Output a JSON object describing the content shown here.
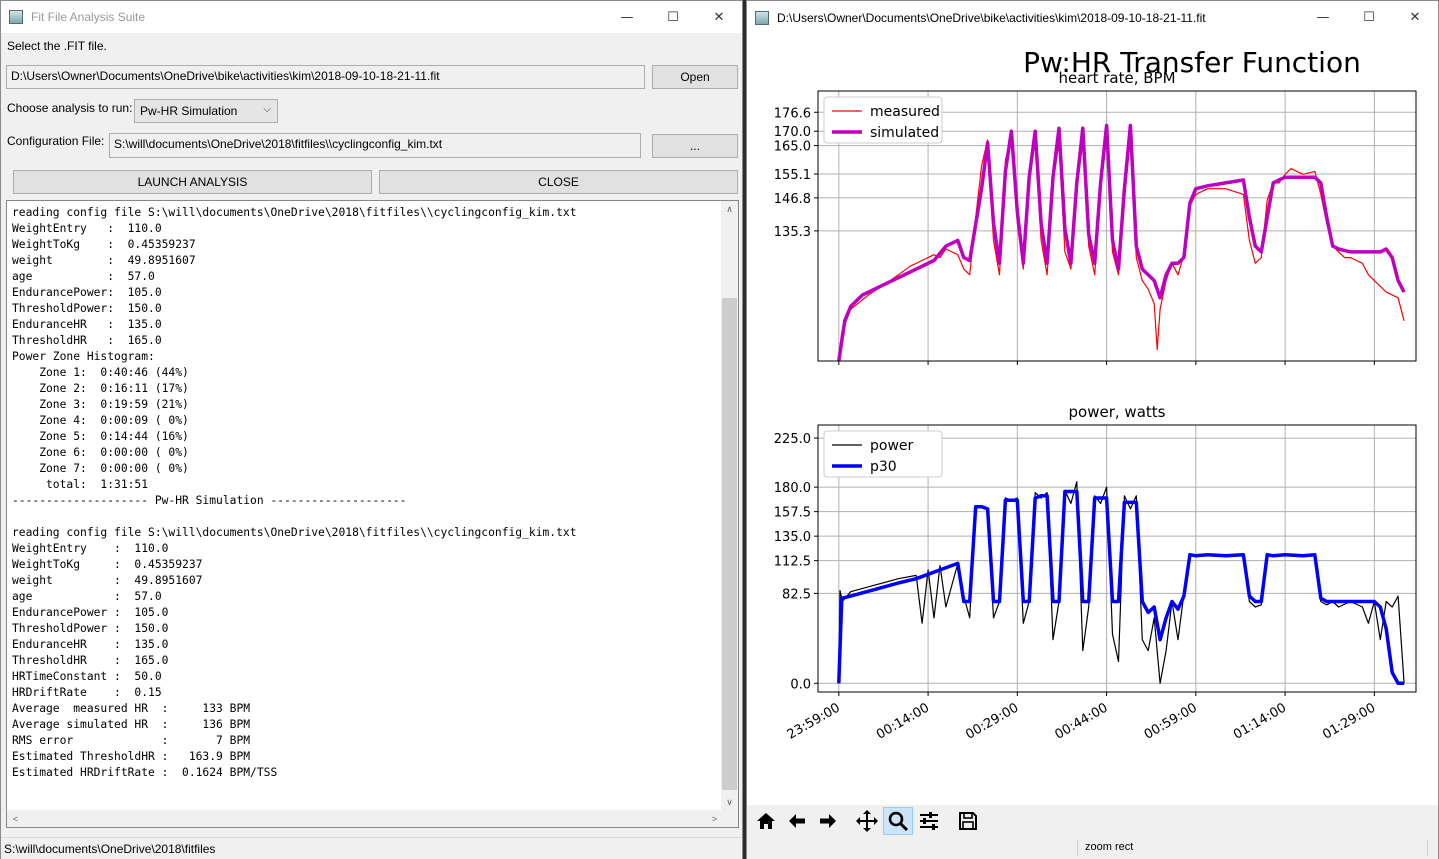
{
  "left_window": {
    "title": "Fit File Analysis Suite",
    "select_label": "Select the .FIT file.",
    "fit_path": "D:\\Users\\Owner\\Documents\\OneDrive\\bike\\activities\\kim\\2018-09-10-18-21-11.fit",
    "open_label": "Open",
    "analysis_label": "Choose analysis to run:",
    "analysis_value": "Pw-HR Simulation",
    "config_label": "Configuration File:",
    "config_path": "S:\\will\\documents\\OneDrive\\2018\\fitfiles\\\\cyclingconfig_kim.txt",
    "browse_label": "...",
    "launch_label": "LAUNCH ANALYSIS",
    "close_label": "CLOSE",
    "log_lines": [
      "reading config file S:\\will\\documents\\OneDrive\\2018\\fitfiles\\\\cyclingconfig_kim.txt",
      "WeightEntry   :  110.0",
      "WeightToKg    :  0.45359237",
      "weight        :  49.8951607",
      "age           :  57.0",
      "EndurancePower:  105.0",
      "ThresholdPower:  150.0",
      "EnduranceHR   :  135.0",
      "ThresholdHR   :  165.0",
      "Power Zone Histogram:",
      "    Zone 1:  0:40:46 (44%)",
      "    Zone 2:  0:16:11 (17%)",
      "    Zone 3:  0:19:59 (21%)",
      "    Zone 4:  0:00:09 ( 0%)",
      "    Zone 5:  0:14:44 (16%)",
      "    Zone 6:  0:00:00 ( 0%)",
      "    Zone 7:  0:00:00 ( 0%)",
      "     total:  1:31:51",
      "-------------------- Pw-HR Simulation --------------------",
      "",
      "reading config file S:\\will\\documents\\OneDrive\\2018\\fitfiles\\\\cyclingconfig_kim.txt",
      "WeightEntry    :  110.0",
      "WeightToKg     :  0.45359237",
      "weight         :  49.8951607",
      "age            :  57.0",
      "EndurancePower :  105.0",
      "ThresholdPower :  150.0",
      "EnduranceHR    :  135.0",
      "ThresholdHR    :  165.0",
      "HRTimeConstant :  50.0",
      "HRDriftRate    :  0.15",
      "Average  measured HR  :     133 BPM",
      "Average simulated HR  :     136 BPM",
      "RMS error             :       7 BPM",
      "Estimated ThresholdHR :   163.9 BPM",
      "Estimated HRDriftRate :  0.1624 BPM/TSS"
    ],
    "status": "S:\\will\\documents\\OneDrive\\2018\\fitfiles"
  },
  "right_window": {
    "title": "D:\\Users\\Owner\\Documents\\OneDrive\\bike\\activities\\kim\\2018-09-10-18-21-11.fit",
    "status": "zoom rect",
    "toolbar_icons": [
      "home-icon",
      "back-arrow-icon",
      "forward-arrow-icon",
      "pan-icon",
      "zoom-icon",
      "configure-subplots-icon",
      "save-icon"
    ],
    "active_tool": "zoom-icon"
  },
  "chart_data": [
    {
      "type": "line",
      "suptitle": "Pw:HR Transfer Function",
      "title": "heart rate, BPM",
      "yticks": [
        135.3,
        146.8,
        155.1,
        165.0,
        170.0,
        176.6
      ],
      "ylim": [
        90,
        184
      ],
      "xticks": [
        "23:59:00",
        "00:14:00",
        "00:29:00",
        "00:44:00",
        "00:59:00",
        "01:14:00",
        "01:29:00"
      ],
      "xlim_minutes": [
        -3.5,
        97
      ],
      "grid": true,
      "legend_position": "top-left",
      "series": [
        {
          "name": "measured",
          "color": "#ff0000",
          "x_minutes": [
            0,
            0.5,
            2,
            5,
            8,
            10,
            12,
            14,
            16,
            17,
            18,
            20,
            21,
            22,
            23,
            24,
            25,
            26,
            27,
            28,
            29,
            30,
            31,
            32,
            33,
            34,
            35,
            36,
            37,
            38,
            39,
            40,
            41,
            42,
            43,
            44,
            45,
            46,
            47,
            48,
            49,
            50,
            51,
            52,
            53,
            53.5,
            54,
            55,
            56,
            57,
            58,
            59,
            60,
            62,
            65,
            68,
            69,
            70,
            71,
            72,
            73,
            74,
            75,
            76,
            78,
            80,
            81,
            82,
            83,
            84,
            85,
            86,
            87,
            88,
            89,
            90,
            91,
            92,
            93,
            94,
            95
          ],
          "values": [
            92,
            100,
            108,
            113,
            117,
            120,
            123,
            125,
            127,
            126,
            129,
            127,
            122,
            120,
            140,
            158,
            167,
            132,
            120,
            160,
            168,
            138,
            122,
            155,
            168,
            132,
            120,
            152,
            166,
            128,
            122,
            150,
            166,
            130,
            120,
            150,
            168,
            128,
            120,
            146,
            168,
            126,
            118,
            115,
            110,
            94,
            108,
            118,
            124,
            120,
            127,
            144,
            148,
            150,
            150,
            148,
            132,
            124,
            126,
            146,
            152,
            152,
            155,
            157,
            155,
            156,
            148,
            138,
            130,
            128,
            126,
            126,
            125,
            124,
            120,
            118,
            116,
            114,
            113,
            112,
            104
          ]
        },
        {
          "name": "simulated",
          "color": "#bf00bf",
          "x_minutes": [
            0,
            1,
            2,
            4,
            8,
            12,
            16,
            18,
            20,
            21,
            22,
            24,
            25,
            26,
            27,
            28,
            29,
            30,
            31,
            32,
            33,
            34,
            35,
            36,
            37,
            38,
            39,
            40,
            41,
            42,
            43,
            44,
            45,
            46,
            47,
            48,
            49,
            50,
            51,
            52,
            53,
            54,
            55,
            56,
            57,
            58,
            59,
            60,
            62,
            65,
            68,
            69,
            70,
            71,
            72,
            73,
            74,
            75,
            77,
            80,
            81,
            82,
            83,
            84,
            86,
            88,
            90,
            91,
            92,
            93,
            94,
            95
          ],
          "values": [
            90,
            104,
            109,
            113,
            117,
            121,
            125,
            130,
            132,
            126,
            125,
            150,
            166,
            138,
            124,
            156,
            170,
            142,
            124,
            154,
            170,
            138,
            124,
            154,
            171,
            136,
            124,
            152,
            171,
            134,
            124,
            152,
            172,
            132,
            122,
            150,
            172,
            130,
            122,
            120,
            118,
            112,
            120,
            124,
            124,
            126,
            145,
            150,
            151,
            152,
            153,
            140,
            130,
            128,
            140,
            152,
            153,
            154,
            154,
            154,
            152,
            140,
            130,
            129,
            128,
            128,
            128,
            128,
            129,
            126,
            118,
            114
          ]
        }
      ]
    },
    {
      "type": "line",
      "title": "power, watts",
      "yticks": [
        0.0,
        82.5,
        112.5,
        135.0,
        157.5,
        180.0,
        225.0
      ],
      "ylim": [
        -8,
        237
      ],
      "xticks": [
        "23:59:00",
        "00:14:00",
        "00:29:00",
        "00:44:00",
        "00:59:00",
        "01:14:00",
        "01:29:00"
      ],
      "xlim_minutes": [
        -3.5,
        97
      ],
      "grid": true,
      "legend_position": "top-left",
      "series": [
        {
          "name": "power",
          "color": "#000000",
          "x_minutes": [
            0,
            0.2,
            0.6,
            2,
            6,
            10,
            13,
            14,
            15,
            16,
            17,
            18,
            20,
            21,
            22,
            23,
            24,
            25,
            26,
            27,
            28,
            29,
            30,
            31,
            32,
            33,
            34,
            35,
            36,
            37,
            38,
            39,
            40,
            41,
            42,
            43,
            44,
            45,
            46,
            47,
            48,
            49,
            50,
            51,
            52,
            53,
            54,
            55,
            56,
            57,
            58,
            59,
            60,
            62,
            65,
            68,
            69,
            70,
            71,
            72,
            73,
            75,
            78,
            80,
            81,
            82,
            83,
            84,
            86,
            88,
            89,
            90,
            91,
            92,
            93,
            94,
            95
          ],
          "values": [
            0,
            85,
            75,
            84,
            90,
            96,
            99,
            55,
            104,
            60,
            108,
            70,
            110,
            80,
            60,
            163,
            163,
            160,
            60,
            75,
            170,
            168,
            170,
            55,
            75,
            175,
            170,
            175,
            40,
            75,
            177,
            165,
            185,
            30,
            70,
            172,
            165,
            180,
            45,
            20,
            172,
            160,
            172,
            40,
            30,
            60,
            0,
            30,
            75,
            40,
            82,
            118,
            117,
            118,
            116,
            118,
            75,
            70,
            72,
            118,
            117,
            118,
            116,
            118,
            75,
            72,
            75,
            70,
            75,
            70,
            55,
            75,
            40,
            75,
            70,
            80,
            0
          ]
        },
        {
          "name": "p30",
          "color": "#0000ff",
          "x_minutes": [
            0,
            0.5,
            2,
            6,
            10,
            13,
            15,
            17,
            20,
            21,
            22,
            23,
            24,
            25,
            26,
            27,
            28,
            29,
            30,
            31,
            32,
            33,
            34,
            35,
            36,
            37,
            38,
            39,
            40,
            41,
            42,
            43,
            44,
            45,
            46,
            47,
            48,
            49,
            50,
            51,
            52,
            53,
            54,
            55,
            56,
            57,
            58,
            59,
            60,
            62,
            65,
            68,
            69,
            70,
            71,
            72,
            73,
            75,
            78,
            80,
            81,
            82,
            83,
            84,
            86,
            88,
            90,
            91,
            92,
            93,
            94,
            95
          ],
          "values": [
            0,
            78,
            80,
            86,
            92,
            96,
            100,
            104,
            110,
            75,
            75,
            162,
            162,
            160,
            75,
            75,
            168,
            168,
            168,
            75,
            75,
            170,
            172,
            172,
            75,
            75,
            176,
            176,
            176,
            75,
            75,
            170,
            170,
            170,
            75,
            75,
            166,
            166,
            166,
            75,
            65,
            70,
            40,
            60,
            75,
            68,
            80,
            118,
            117,
            118,
            117,
            118,
            80,
            75,
            75,
            118,
            117,
            118,
            117,
            118,
            78,
            75,
            75,
            75,
            75,
            75,
            75,
            70,
            50,
            10,
            0,
            0
          ]
        }
      ]
    }
  ]
}
